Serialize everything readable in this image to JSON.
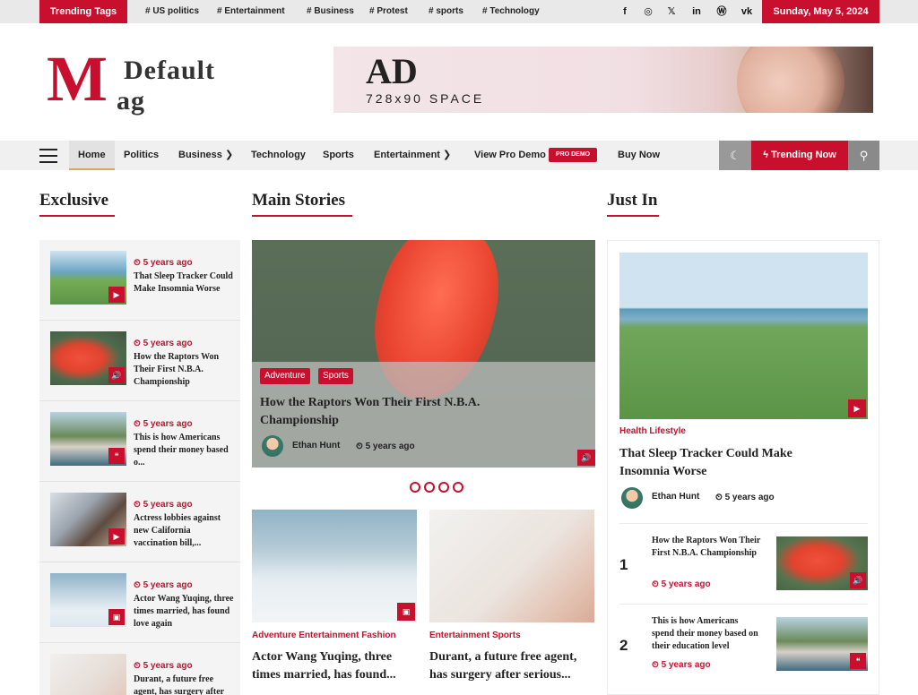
{
  "topbar": {
    "trending_label": "Trending Tags",
    "tags": [
      "# US politics",
      "# Entertainment",
      "# Business",
      "# Protest",
      "# sports",
      "# Technology"
    ],
    "socials": [
      {
        "name": "facebook-icon",
        "glyph": "f"
      },
      {
        "name": "instagram-icon",
        "glyph": "◎"
      },
      {
        "name": "x-icon",
        "glyph": "𝕏"
      },
      {
        "name": "linkedin-icon",
        "glyph": "in"
      },
      {
        "name": "wordpress-icon",
        "glyph": "Ⓦ"
      },
      {
        "name": "vk-icon",
        "glyph": "vk"
      }
    ],
    "date": "Sunday, May 5, 2024"
  },
  "logo": {
    "letter": "M",
    "line1": "Default",
    "line2": "ag"
  },
  "ad": {
    "title": "AD",
    "subtitle": "728x90 SPACE"
  },
  "nav": {
    "items": [
      "Home",
      "Politics",
      "Business ❯",
      "Technology",
      "Sports",
      "Entertainment ❯",
      "View Pro Demo",
      "Buy Now"
    ],
    "pro_badge": "PRO DEMO",
    "trending_btn": "ϟ Trending Now",
    "dark_glyph": "☾",
    "search_glyph": "⚲"
  },
  "sections": {
    "exclusive": "Exclusive",
    "main": "Main Stories",
    "justin": "Just In"
  },
  "exclusive": [
    {
      "time": "⏲ 5 years ago",
      "title": "That Sleep Tracker Could Make Insomnia Worse",
      "badge": "▶",
      "theme": "beach"
    },
    {
      "time": "⏲ 5 years ago",
      "title": "How the Raptors Won Their First N.B.A. Championship",
      "badge": "🔊",
      "theme": "shoe"
    },
    {
      "time": "⏲ 5 years ago",
      "title": "This is how Americans spend their money based o...",
      "badge": "❝",
      "theme": "palm"
    },
    {
      "time": "⏲ 5 years ago",
      "title": "Actress lobbies against new California vaccination bill,...",
      "badge": "▶",
      "theme": "city"
    },
    {
      "time": "⏲ 5 years ago",
      "title": "Actor Wang Yuqing, three times married, has found love again",
      "badge": "▣",
      "theme": "snow"
    },
    {
      "time": "⏲ 5 years ago",
      "title": "Durant, a future free agent, has surgery after serious...",
      "badge": "",
      "theme": "face"
    }
  ],
  "slider": {
    "cats": [
      "Adventure",
      "Sports"
    ],
    "title": "How the Raptors Won Their First N.B.A. Championship",
    "author": "Ethan Hunt",
    "time": "⏲ 5 years ago",
    "vol": "🔊"
  },
  "cards": [
    {
      "cats": "Adventure  Entertainment  Fashion",
      "title": "Actor Wang Yuqing, three times married, has found...",
      "badge": "▣"
    },
    {
      "cats": "Entertainment  Sports",
      "title": "Durant, a future free agent, has surgery after serious..."
    }
  ],
  "justin": {
    "main": {
      "cats": "Health  Lifestyle",
      "title": "That Sleep Tracker Could Make Insomnia Worse",
      "author": "Ethan Hunt",
      "time": "⏲ 5 years ago",
      "badge": "▶"
    },
    "list": [
      {
        "num": "1",
        "title": "How the Raptors Won Their First N.B.A. Championship",
        "time": "⏲ 5 years ago",
        "badge": "🔊"
      },
      {
        "num": "2",
        "title": "This is how Americans spend their money based on their education level",
        "time": "⏲ 5 years ago",
        "badge": "❝"
      }
    ]
  }
}
